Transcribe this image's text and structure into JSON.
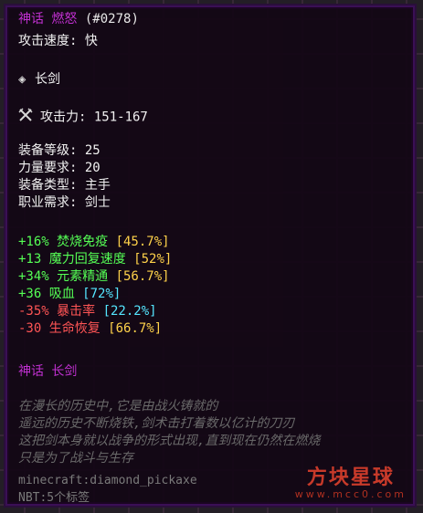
{
  "tooltip": {
    "title_name": "神话 燃怒",
    "title_id": "(#0278)",
    "attack_speed": "攻击速度: 快",
    "weapon_type_icon": "diamond-icon",
    "weapon_type": "长剑",
    "attack_icon": "crossed-swords-icon",
    "attack_label": "攻击力: 151-167",
    "stats": [
      "装备等级: 25",
      "力量要求: 20",
      "装备类型: 主手",
      "职业需求: 剑士"
    ],
    "bonuses": [
      {
        "value": "+16%",
        "name": " 焚烧免疫 ",
        "roll": "[45.7%]",
        "value_color": "#55ff55",
        "roll_color": "#ffd24a"
      },
      {
        "value": "+13",
        "name": " 魔力回复速度 ",
        "roll": "[52%]",
        "value_color": "#55ff55",
        "roll_color": "#ffd24a"
      },
      {
        "value": "+34%",
        "name": " 元素精通 ",
        "roll": "[56.7%]",
        "value_color": "#55ff55",
        "roll_color": "#ffd24a"
      },
      {
        "value": "+36",
        "name": " 吸血 ",
        "roll": "[72%]",
        "value_color": "#55ff55",
        "roll_color": "#55e6ff"
      },
      {
        "value": "-35%",
        "name": " 暴击率 ",
        "roll": "[22.2%]",
        "value_color": "#ff5555",
        "roll_color": "#55e6ff"
      },
      {
        "value": "-30",
        "name": " 生命恢复 ",
        "roll": "[66.7%]",
        "value_color": "#ff5555",
        "roll_color": "#ffd24a"
      }
    ],
    "rarity_line": "神话 长剑",
    "lore": [
      "在漫长的历史中,它是由战火铸就的",
      "遥远的历史不断烧铁,剑术击打着数以亿计的刀刃",
      "这把剑本身就以战争的形式出现,直到现在仍然在燃烧",
      "只是为了战斗与生存"
    ],
    "item_id": "minecraft:diamond_pickaxe",
    "nbt": "NBT:5个标签"
  },
  "watermark": {
    "title": "方块星球",
    "url": "www.mcc0.com"
  },
  "colors": {
    "title": "#c030d0",
    "positive": "#55ff55",
    "negative": "#ff5555",
    "roll_gold": "#ffd24a",
    "roll_aqua": "#55e6ff",
    "lore": "#6a6a6a"
  }
}
